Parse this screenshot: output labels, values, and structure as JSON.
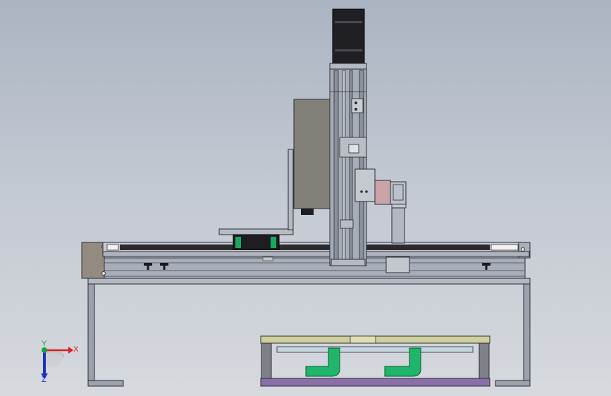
{
  "triad": {
    "x_label": "X",
    "y_label": "Y",
    "z_label": "Z"
  },
  "colors": {
    "background_top": "#aab4c2",
    "background_bottom": "#d6d9de",
    "frame_steel": "#9ba1ad",
    "frame_outline": "#2b2d33",
    "rail_dark": "#2a2a30",
    "column": "#a7adb7",
    "panel_box": "#83807a",
    "motor": "#202024",
    "pink_block": "#c9a3a7",
    "nozzle": "#b3b7c1",
    "tray_top": "#cfcf9e",
    "tray_glass": "#c6d6df",
    "green_pipe": "#1fb56a",
    "purple_base": "#8a6fa8",
    "axis_x": "#d62020",
    "axis_y": "#18a040",
    "axis_z": "#2030c0"
  }
}
